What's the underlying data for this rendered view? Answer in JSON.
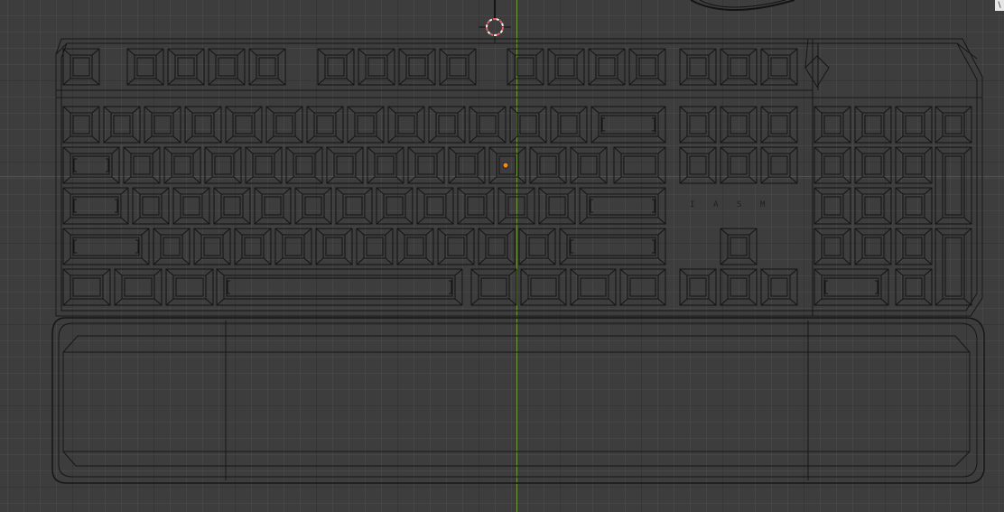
{
  "viewport": {
    "colors": {
      "background": "#3d3d3d",
      "grid_minor": "#434343",
      "grid_major": "#363636",
      "x_axis": "#8a3a3a",
      "y_axis": "#6f9a3a",
      "wire": "#141414",
      "origin_dot": "#f08a1e",
      "cursor_ring": "#e06060"
    },
    "corner_badge": "\\",
    "modifier_labels": [
      "I",
      "A",
      "S",
      "M"
    ]
  }
}
